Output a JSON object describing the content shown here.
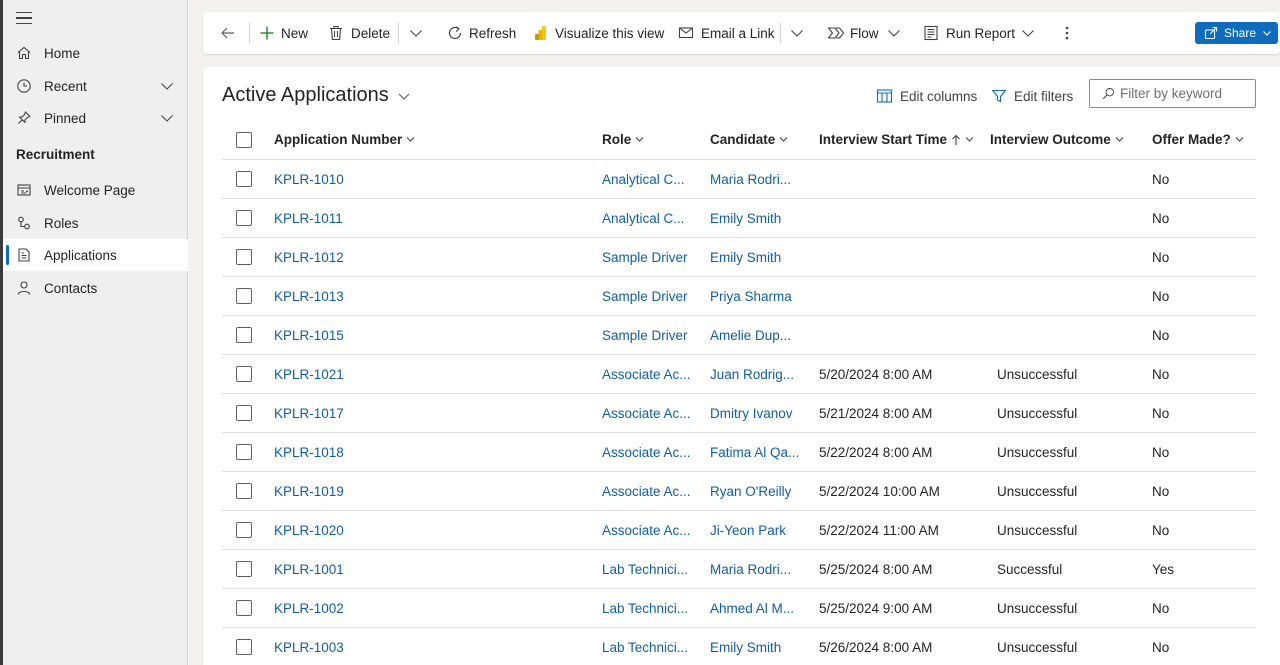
{
  "sidebar": {
    "items": [
      {
        "label": "Home",
        "icon": "home-icon"
      },
      {
        "label": "Recent",
        "icon": "clock-icon"
      },
      {
        "label": "Pinned",
        "icon": "pin-icon"
      }
    ],
    "group_label": "Recruitment",
    "group_items": [
      {
        "label": "Welcome Page",
        "icon": "welcome-page-icon"
      },
      {
        "label": "Roles",
        "icon": "roles-icon"
      },
      {
        "label": "Applications",
        "icon": "applications-icon",
        "active": true
      },
      {
        "label": "Contacts",
        "icon": "contact-icon"
      }
    ]
  },
  "toolbar": {
    "new_label": "New",
    "delete_label": "Delete",
    "refresh_label": "Refresh",
    "visualize_label": "Visualize this view",
    "email_label": "Email a Link",
    "flow_label": "Flow",
    "run_report_label": "Run Report",
    "share_label": "Share"
  },
  "view": {
    "title": "Active Applications",
    "edit_columns_label": "Edit columns",
    "edit_filters_label": "Edit filters",
    "filter_placeholder": "Filter by keyword"
  },
  "grid": {
    "columns": [
      "Application Number",
      "Role",
      "Candidate",
      "Interview Start Time",
      "Interview Outcome",
      "Offer Made?"
    ],
    "rows": [
      {
        "number": "KPLR-1010",
        "role": "Analytical C...",
        "candidate": "Maria Rodri...",
        "start": "",
        "outcome": "",
        "offer": "No"
      },
      {
        "number": "KPLR-1011",
        "role": "Analytical C...",
        "candidate": "Emily Smith",
        "start": "",
        "outcome": "",
        "offer": "No"
      },
      {
        "number": "KPLR-1012",
        "role": "Sample Driver",
        "candidate": "Emily Smith",
        "start": "",
        "outcome": "",
        "offer": "No"
      },
      {
        "number": "KPLR-1013",
        "role": "Sample Driver",
        "candidate": "Priya Sharma",
        "start": "",
        "outcome": "",
        "offer": "No"
      },
      {
        "number": "KPLR-1015",
        "role": "Sample Driver",
        "candidate": "Amelie Dup...",
        "start": "",
        "outcome": "",
        "offer": "No"
      },
      {
        "number": "KPLR-1021",
        "role": "Associate Ac...",
        "candidate": "Juan Rodrig...",
        "start": "5/20/2024 8:00 AM",
        "outcome": "Unsuccessful",
        "offer": "No"
      },
      {
        "number": "KPLR-1017",
        "role": "Associate Ac...",
        "candidate": "Dmitry Ivanov",
        "start": "5/21/2024 8:00 AM",
        "outcome": "Unsuccessful",
        "offer": "No"
      },
      {
        "number": "KPLR-1018",
        "role": "Associate Ac...",
        "candidate": "Fatima Al Qa...",
        "start": "5/22/2024 8:00 AM",
        "outcome": "Unsuccessful",
        "offer": "No"
      },
      {
        "number": "KPLR-1019",
        "role": "Associate Ac...",
        "candidate": "Ryan O'Reilly",
        "start": "5/22/2024 10:00 AM",
        "outcome": "Unsuccessful",
        "offer": "No"
      },
      {
        "number": "KPLR-1020",
        "role": "Associate Ac...",
        "candidate": "Ji-Yeon Park",
        "start": "5/22/2024 11:00 AM",
        "outcome": "Unsuccessful",
        "offer": "No"
      },
      {
        "number": "KPLR-1001",
        "role": "Lab Technici...",
        "candidate": "Maria Rodri...",
        "start": "5/25/2024 8:00 AM",
        "outcome": "Successful",
        "offer": "Yes"
      },
      {
        "number": "KPLR-1002",
        "role": "Lab Technici...",
        "candidate": "Ahmed Al M...",
        "start": "5/25/2024 9:00 AM",
        "outcome": "Unsuccessful",
        "offer": "No"
      },
      {
        "number": "KPLR-1003",
        "role": "Lab Technici...",
        "candidate": "Emily Smith",
        "start": "5/26/2024 8:00 AM",
        "outcome": "Unsuccessful",
        "offer": "No"
      }
    ]
  },
  "colors": {
    "accent": "#0f6cbd",
    "link": "#115ea3"
  }
}
